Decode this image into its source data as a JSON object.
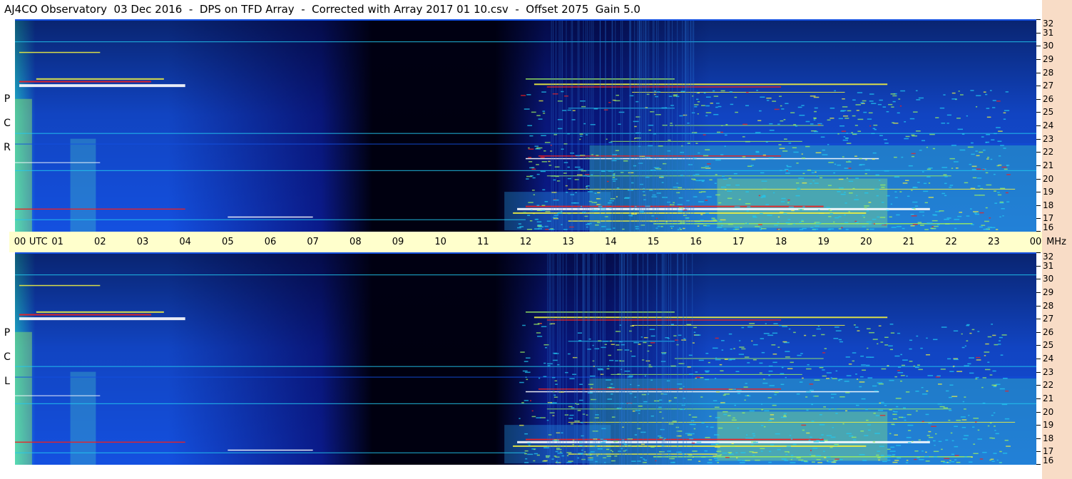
{
  "title": "AJ4CO Observatory  03 Dec 2016  -  DPS on TFD Array  -  Corrected with Array 2017 01 10.csv  -  Offset 2075  Gain 5.0",
  "rcp_label": [
    "R",
    "C",
    "P"
  ],
  "lcp_label": [
    "L",
    "C",
    "P"
  ],
  "chart_data": {
    "type": "heatmap",
    "title": "AJ4CO Observatory  03 Dec 2016  -  DPS on TFD Array  -  Corrected with Array 2017 01 10.csv  -  Offset 2075  Gain 5.0",
    "x_unit": "UTC",
    "y_unit": "MHz",
    "x_ticks": [
      "00",
      "01",
      "02",
      "03",
      "04",
      "05",
      "06",
      "07",
      "08",
      "09",
      "10",
      "11",
      "12",
      "13",
      "14",
      "15",
      "16",
      "17",
      "18",
      "19",
      "20",
      "21",
      "22",
      "23",
      "00"
    ],
    "x_range": [
      0,
      24
    ],
    "y_ticks": [
      16,
      17,
      18,
      19,
      20,
      21,
      22,
      23,
      24,
      25,
      26,
      27,
      28,
      29,
      30,
      31,
      32
    ],
    "y_range": [
      16,
      32
    ],
    "panels": [
      "RCP",
      "LCP"
    ],
    "colors": {
      "dark": "#000010",
      "deep_blue": "#0a1a8a",
      "blue": "#1450e0",
      "cyan": "#22c8f0",
      "green": "#9cf060",
      "yellow": "#f0f040",
      "red": "#f02020",
      "white": "#ffffff"
    }
  }
}
